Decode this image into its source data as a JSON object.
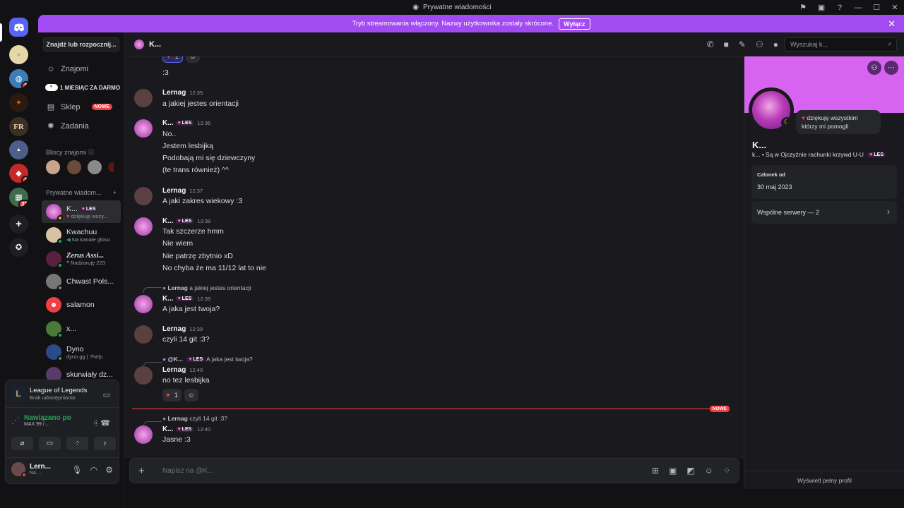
{
  "window": {
    "title": "Prywatne wiadomości"
  },
  "banner": {
    "text": "Tryb streamowania włączony. Nazwy użytkownika zostały skrócone.",
    "button": "Wyłącz"
  },
  "servers": {
    "badges": [
      "1",
      "1",
      "31"
    ]
  },
  "dm_sidebar": {
    "search_button": "Znajdź lub rozpocznij...",
    "nav": {
      "friends": "Znajomi",
      "promo": "1 MIESIĄC ZA DARMO",
      "shop": "Sklep",
      "shop_badge": "NOWE",
      "quests": "Zadania"
    },
    "close_friends_label": "Bliscy znajomi",
    "dm_label": "Prywatne wiadom...",
    "dms": [
      {
        "name": "K...",
        "tag": "LES",
        "status": "dziękuję wszy..."
      },
      {
        "name": "Kwachuu",
        "status": "Na kanale głoso"
      },
      {
        "name": "Zerus Assi...",
        "status": "Nadzoruję 223"
      },
      {
        "name": "Chwast Pols...",
        "status": ""
      },
      {
        "name": "salamon",
        "status": ""
      },
      {
        "name": "x...",
        "status": ""
      },
      {
        "name": "Dyno",
        "status": "dyno.gg | ?help"
      },
      {
        "name": "skurwiały dz...",
        "status": ""
      }
    ]
  },
  "activity": {
    "game": "League of Legends",
    "share": "Brak udostępniania",
    "voice_status": "Nawiązano po",
    "voice_detail": "MAX 99 / ..."
  },
  "me": {
    "name": "Lern...",
    "status": "Na ..."
  },
  "chat": {
    "header_name": "K...",
    "search_placeholder": "Wyszukaj k...",
    "composer_placeholder": "Napisz na @K...",
    "top_reaction_count": "1",
    "messages": {
      "m0": {
        "line1": ":3"
      },
      "m1": {
        "author": "Lernag",
        "time": "12:35",
        "line1": "a jakiej jestes orientacji"
      },
      "m2": {
        "author": "K...",
        "tag": "LES",
        "time": "12:36",
        "line1": "No..",
        "line2": "Jestem lesbijką",
        "line3": "Podobają mi się dziewczyny",
        "line4": "(te trans również) ^^"
      },
      "m3": {
        "author": "Lernag",
        "time": "12:37",
        "line1": "A jaki zakres wiekowy :3"
      },
      "m4": {
        "author": "K...",
        "tag": "LES",
        "time": "12:38",
        "line1": "Tak szczerze hmm",
        "line2": "Nie wiem",
        "line3": "Nie patrzę zbytnio xD",
        "line4": "No chyba że ma 11/12 lat to nie"
      },
      "m5": {
        "reply_author": "Lernag",
        "reply_text": "a jakiej jestes orientacji",
        "author": "K...",
        "tag": "LES",
        "time": "12:39",
        "line1": "A jaka jest twoja?"
      },
      "m6": {
        "author": "Lernag",
        "time": "12:39",
        "line1": "czyli 14 git :3?"
      },
      "m7": {
        "reply_author": "@K...",
        "reply_tag": "LES",
        "reply_text": "A jaka jest twoja?",
        "author": "Lernag",
        "time": "12:40",
        "line1": "no tez lesbijka",
        "reaction_count": "1"
      },
      "m8": {
        "reply_author": "Lernag",
        "reply_text": "czyli 14 git :3?",
        "author": "K...",
        "tag": "LES",
        "time": "12:40",
        "line1": "Jasne :3"
      }
    },
    "new_divider": "NOWE"
  },
  "profile": {
    "status_bubble": "dziękuję wszystkim którzy mi pomogli",
    "name": "K...",
    "handle": "k...",
    "bio": "Są w Ojczyźnie rachunki krzywd U-U",
    "tag": "LES",
    "member_since_label": "Członek od",
    "member_since": "30 maj 2023",
    "mutual_servers": "Wspólne serwery — 2",
    "footer": "Wyświetl pełny profil"
  },
  "colors": {
    "accent": "#a34bf2",
    "profile_banner": "#d664f0",
    "online": "#23a55a",
    "danger": "#f23f43",
    "blurple": "#5865f2"
  }
}
